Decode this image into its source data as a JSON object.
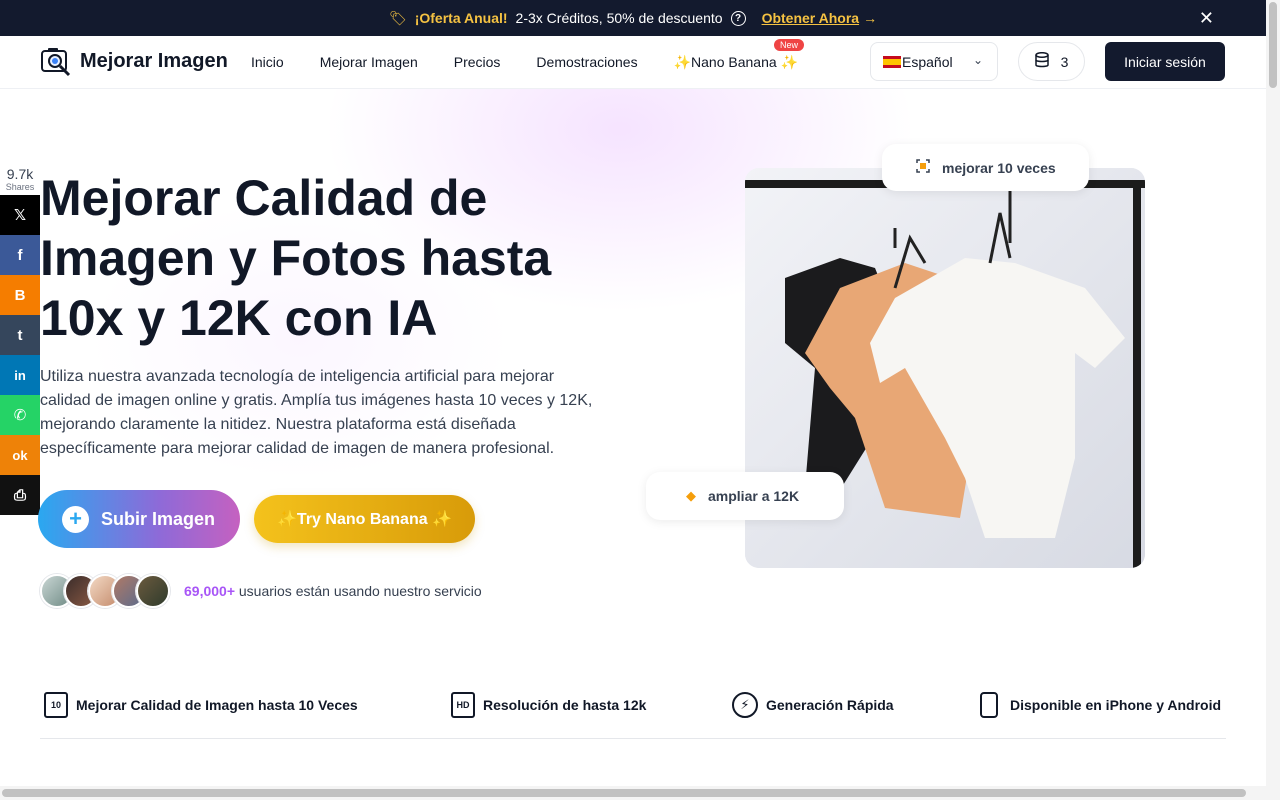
{
  "promo": {
    "offer_strong": "¡Oferta Anual!",
    "offer_text": "2-3x Créditos, 50% de descuento",
    "link_label": "Obtener Ahora",
    "help_icon": "question-circle-icon",
    "close_icon": "close-icon"
  },
  "header": {
    "logo_text": "Mejorar Imagen",
    "nav": [
      {
        "label": "Inicio"
      },
      {
        "label": "Mejorar Imagen"
      },
      {
        "label": "Precios"
      },
      {
        "label": "Demostraciones"
      },
      {
        "label": "✨Nano Banana ✨",
        "badge": "New"
      }
    ],
    "language": "Español",
    "credits": "3",
    "signin_label": "Iniciar sesión"
  },
  "share": {
    "count": "9.7k",
    "label": "Shares",
    "buttons": [
      {
        "name": "x",
        "glyph": "𝕏",
        "color": "#000000"
      },
      {
        "name": "facebook",
        "glyph": "f",
        "color": "#3b5998"
      },
      {
        "name": "blogger",
        "glyph": "B",
        "color": "#f57d00"
      },
      {
        "name": "tumblr",
        "glyph": "t",
        "color": "#35465c"
      },
      {
        "name": "linkedin",
        "glyph": "in",
        "color": "#0077b5"
      },
      {
        "name": "whatsapp",
        "glyph": "✆",
        "color": "#25d366"
      },
      {
        "name": "odnoklassniki",
        "glyph": "ok",
        "color": "#ee8208"
      },
      {
        "name": "print",
        "glyph": "⎙",
        "color": "#111111"
      }
    ]
  },
  "hero": {
    "title": "Mejorar Calidad de Imagen y Fotos hasta 10x y 12K con IA",
    "description": "Utiliza nuestra avanzada tecnología de inteligencia artificial para mejorar calidad de imagen online y gratis. Amplía tus imágenes hasta 10 veces y 12K, mejorando claramente la nitidez. Nuestra plataforma está diseñada específicamente para mejorar calidad de imagen de manera profesional.",
    "upload_label": "Subir Imagen",
    "nano_label": "✨Try Nano Banana ✨",
    "users_count": "69,000+",
    "users_text": " usuarios están usando nuestro servicio",
    "pill_1": "mejorar 10 veces",
    "pill_2": "ampliar a 12K"
  },
  "features": [
    {
      "icon": "enhance-10x-icon",
      "icon_text": "10",
      "label": "Mejorar Calidad de Imagen hasta 10 Veces"
    },
    {
      "icon": "hd-icon",
      "icon_text": "HD",
      "label": "Resolución de hasta 12k"
    },
    {
      "icon": "lightning-icon",
      "icon_text": "⚡",
      "label": "Generación Rápida"
    },
    {
      "icon": "phone-icon",
      "icon_text": "",
      "label": "Disponible en iPhone y Android"
    }
  ]
}
